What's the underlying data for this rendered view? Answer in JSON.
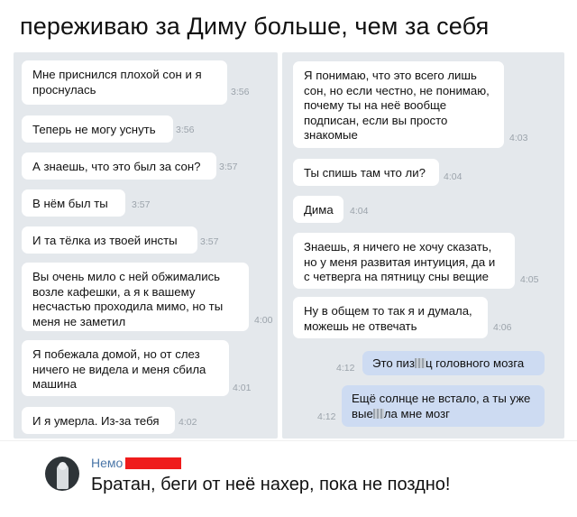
{
  "title": "переживаю за Диму больше, чем за себя",
  "left_messages": [
    {
      "text": "Мне приснился плохой сон и я\nпроснулась",
      "time": "3:56"
    },
    {
      "text": "Теперь не могу уснуть",
      "time": "3:56"
    },
    {
      "text": "А знаешь, что это был за сон?",
      "time": "3:57"
    },
    {
      "text": "В нём был ты",
      "time": "3:57"
    },
    {
      "text": "И та тёлка из твоей инсты",
      "time": "3:57"
    },
    {
      "text": "Вы очень мило с ней обжимались\nвозле кафешки, а я к вашему\nнесчастью проходила мимо, но ты\nменя не заметил",
      "time": "4:00"
    },
    {
      "text": "Я побежала домой, но от слез\nничего не видела и меня сбила\nмашина",
      "time": "4:01"
    },
    {
      "text": "И я умерла. Из-за тебя",
      "time": "4:02"
    }
  ],
  "right_messages": [
    {
      "text": "Я понимаю, что это всего лишь\nсон, но если честно, не понимаю,\nпочему ты на неё вообще\nподписан, если вы просто\nзнакомые",
      "time": "4:03"
    },
    {
      "text": "Ты спишь там что ли?",
      "time": "4:04"
    },
    {
      "text": "Дима",
      "time": "4:04"
    },
    {
      "text": "Знаешь, я ничего не хочу сказать,\nно у меня развитая интуиция, да и\nс четверга на пятницу сны вещие",
      "time": "4:05"
    },
    {
      "text": "Ну в общем то так я и думала,\nможешь не отвечать",
      "time": "4:06"
    }
  ],
  "sent_messages": [
    {
      "part1": "Это пиз",
      "part2": "ц головного мозга",
      "time": "4:12"
    },
    {
      "line1": "Ещё солнце не встало, а ты уже",
      "line2_a": "вые",
      "line2_b": "ла мне мозг",
      "time": "4:12"
    }
  ],
  "comment": {
    "author": "Немо",
    "text": "Братан, беги от неё нахер, пока не поздно!"
  }
}
